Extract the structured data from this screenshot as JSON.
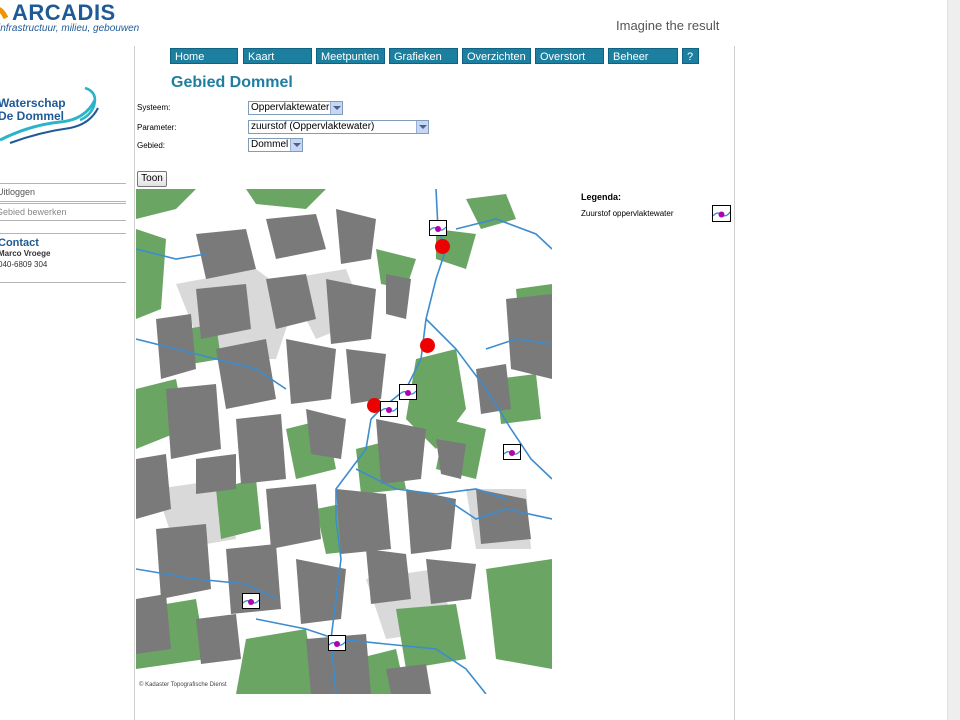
{
  "header": {
    "brand": "ARCADIS",
    "brand_subtitle": "infrastructuur, milieu, gebouwen",
    "tagline": "Imagine the result"
  },
  "sidebar": {
    "org_name_line1": "Waterschap",
    "org_name_line2": "De Dommel",
    "links": [
      {
        "label": "Uitloggen"
      },
      {
        "label": "Gebied bewerken"
      }
    ],
    "contact": {
      "title": "Contact",
      "name": "Marco Vroege",
      "phone": "040-6809 304"
    }
  },
  "nav": {
    "items": [
      {
        "label": "Home"
      },
      {
        "label": "Kaart"
      },
      {
        "label": "Meetpunten"
      },
      {
        "label": "Grafieken"
      },
      {
        "label": "Overzichten"
      },
      {
        "label": "Overstort"
      },
      {
        "label": "Beheer"
      },
      {
        "label": "?"
      }
    ]
  },
  "page": {
    "title": "Gebied Dommel"
  },
  "form": {
    "systeem": {
      "label": "Systeem:",
      "value": "Oppervlaktewater"
    },
    "parameter": {
      "label": "Parameter:",
      "value": "zuurstof (Oppervlaktewater)"
    },
    "gebied": {
      "label": "Gebied:",
      "value": "Dommel"
    },
    "submit_label": "Toon"
  },
  "map": {
    "credit": "© Kadaster Topografische Dienst",
    "colors": {
      "urban": "#7a7a7a",
      "green": "#6aa564",
      "water": "#3d8ccf",
      "light": "#d9d9d9",
      "dot": "#ee0000"
    }
  },
  "legend": {
    "title": "Legenda:",
    "item_label": "Zuurstof oppervlaktewater"
  }
}
